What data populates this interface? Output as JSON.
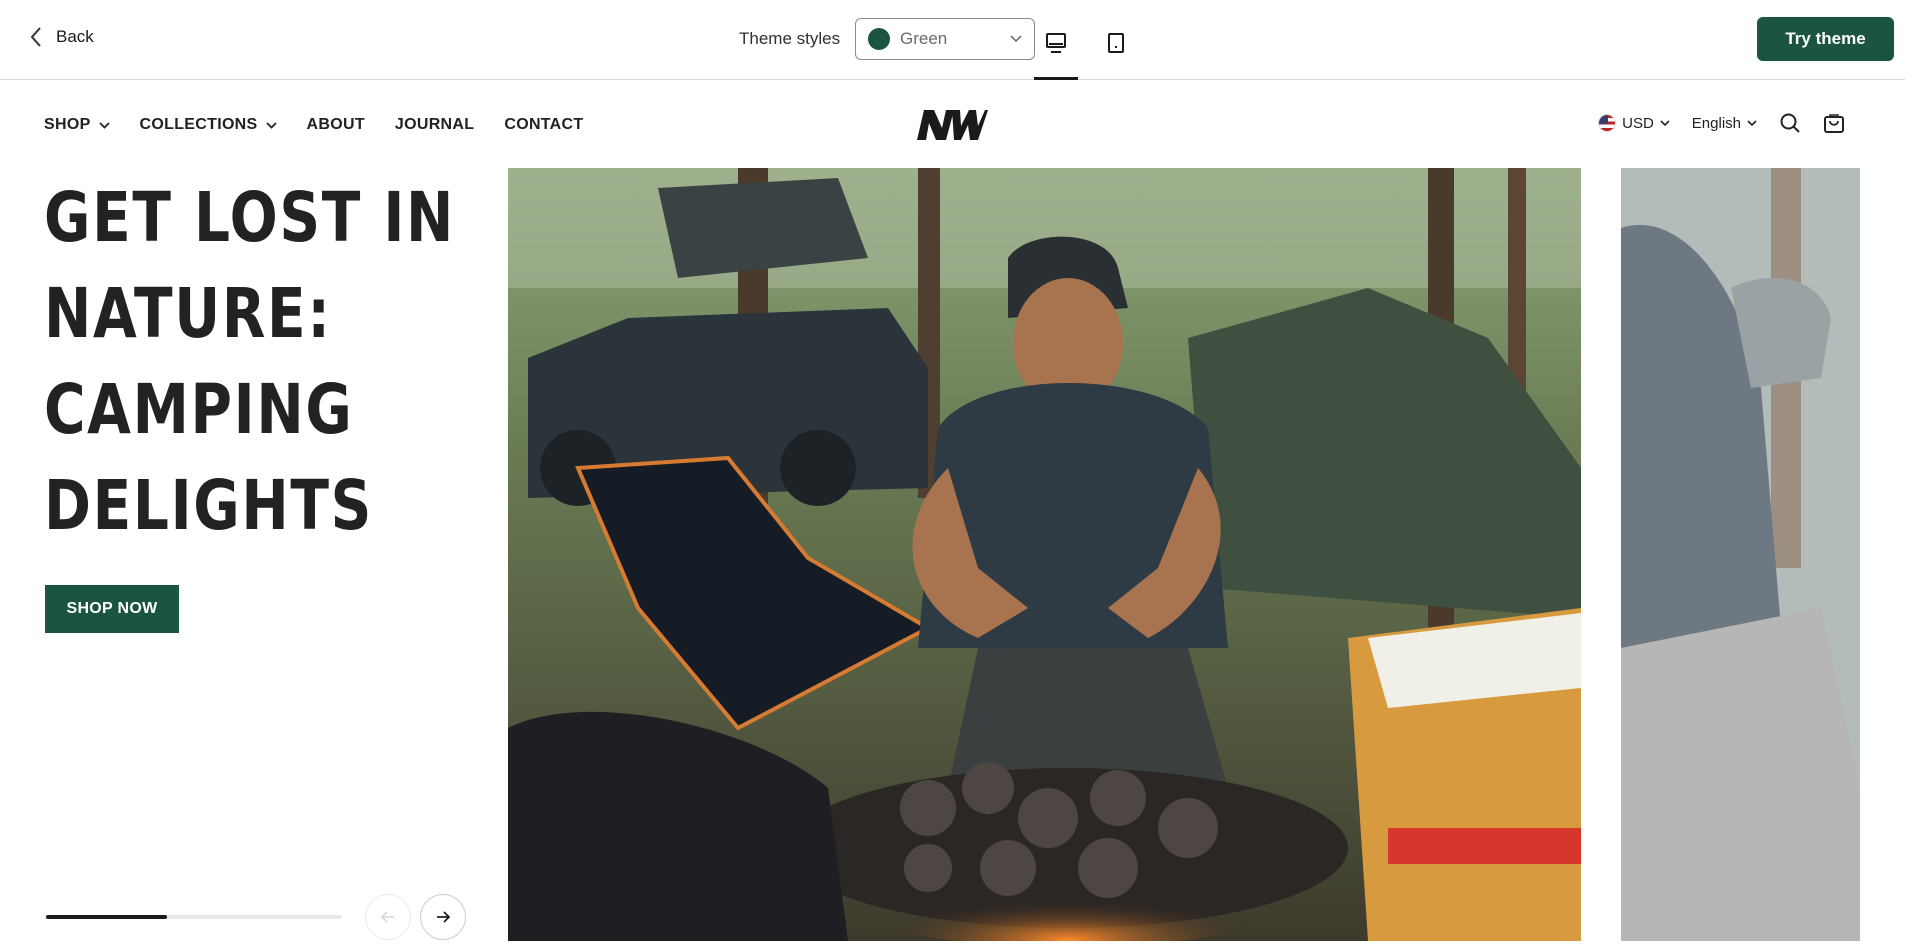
{
  "topbar": {
    "back_label": "Back",
    "theme_styles_label": "Theme styles",
    "theme_selected": "Green",
    "try_label": "Try theme",
    "accent_color": "#1b5440"
  },
  "nav": {
    "items": [
      {
        "label": "SHOP",
        "has_dropdown": true
      },
      {
        "label": "COLLECTIONS",
        "has_dropdown": true
      },
      {
        "label": "ABOUT",
        "has_dropdown": false
      },
      {
        "label": "JOURNAL",
        "has_dropdown": false
      },
      {
        "label": "CONTACT",
        "has_dropdown": false
      }
    ],
    "logo_text": "NW",
    "currency": "USD",
    "language": "English"
  },
  "hero": {
    "title": "GET LOST IN\nNATURE:\nCAMPING\nDELIGHTS",
    "cta_label": "SHOP NOW",
    "slide_progress": 0.41
  }
}
